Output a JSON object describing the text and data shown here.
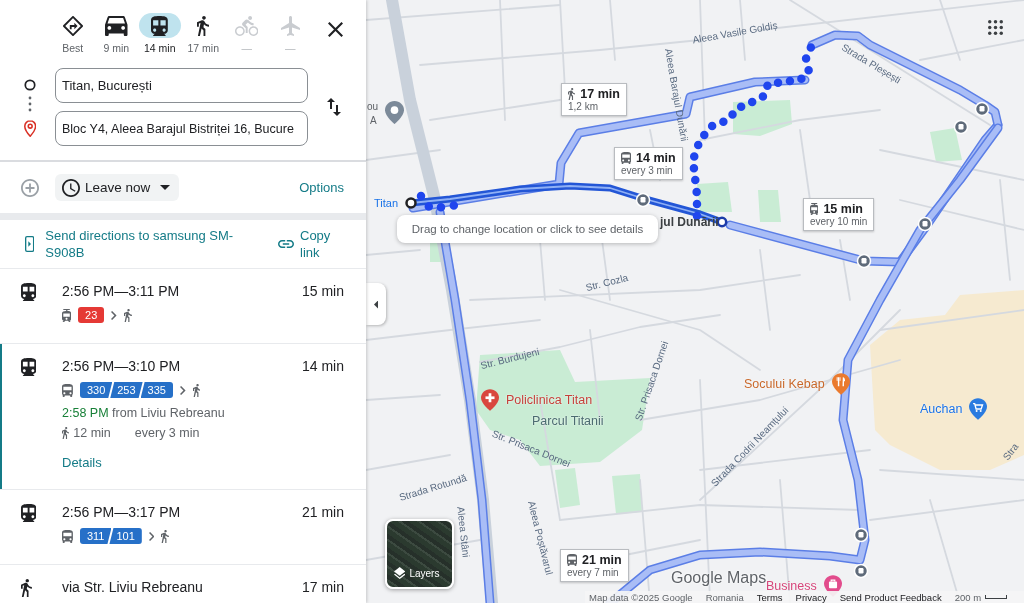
{
  "travel_modes": [
    {
      "kind": "best",
      "label": "Best",
      "selected": false,
      "disabled": false
    },
    {
      "kind": "car",
      "label": "9 min",
      "selected": false,
      "disabled": false
    },
    {
      "kind": "transit",
      "label": "14 min",
      "selected": true,
      "disabled": false
    },
    {
      "kind": "walk",
      "label": "17 min",
      "selected": false,
      "disabled": false
    },
    {
      "kind": "bike",
      "label": "—",
      "selected": false,
      "disabled": true
    },
    {
      "kind": "flight",
      "label": "—",
      "selected": false,
      "disabled": true
    }
  ],
  "origin": {
    "value": "Titan, București"
  },
  "destination": {
    "value": "Bloc Y4, Aleea Barajul Bistriței 16, Bucure"
  },
  "departure_menu": {
    "label": "Leave now"
  },
  "options_link": "Options",
  "share": {
    "send_label": "Send directions to samsung SM-S908B",
    "copy_label": "Copy link"
  },
  "routes": [
    {
      "kind": "transit",
      "selected": false,
      "times": "2:56 PM—3:11 PM",
      "duration": "15 min",
      "legs": [
        {
          "kind": "tram",
          "lines": [
            {
              "name": "23",
              "color": "#e53935"
            }
          ]
        },
        {
          "kind": "walk"
        }
      ]
    },
    {
      "kind": "transit",
      "selected": true,
      "times": "2:56 PM—3:10 PM",
      "duration": "14 min",
      "legs": [
        {
          "kind": "bus",
          "lines": [
            {
              "name": "330",
              "color": "#2670c8"
            },
            {
              "name": "253",
              "color": "#2670c8"
            },
            {
              "name": "335",
              "color": "#2670c8"
            }
          ]
        },
        {
          "kind": "walk"
        }
      ],
      "departure_time": "2:58 PM",
      "departure_place": "from Liviu Rebreanu",
      "walk_time": "12 min",
      "frequency": "every 3 min",
      "details_link": "Details"
    },
    {
      "kind": "transit",
      "selected": false,
      "times": "2:56 PM—3:17 PM",
      "duration": "21 min",
      "legs": [
        {
          "kind": "bus",
          "lines": [
            {
              "name": "311",
              "color": "#2670c8"
            },
            {
              "name": "101",
              "color": "#2670c8"
            }
          ]
        },
        {
          "kind": "walk"
        }
      ]
    },
    {
      "kind": "walk",
      "selected": false,
      "summary": "via Str. Liviu Rebreanu",
      "duration": "17 min"
    }
  ],
  "map": {
    "tooltip": "Drag to change location or click to see details",
    "place_labels": [
      {
        "kind": "origin",
        "text": "Titan"
      },
      {
        "kind": "stop",
        "text": "jul Dunării"
      },
      {
        "kind": "partial",
        "text": "ou"
      },
      {
        "kind": "partial",
        "text": "A"
      }
    ],
    "streets": [
      "Aleea Vasile Goldiș",
      "Strada Pleșești",
      "Aleea Barajul Dunării",
      "Str. Cozla",
      "Str. Burdujeni",
      "Str. Prisaca Dornei",
      "Str. Prisaca Dornei",
      "Strada Rotundă",
      "Aleea Stâni",
      "Aleea Poștăvarul",
      "Strada Codrii Neamțului",
      "Stra"
    ],
    "pois": [
      {
        "kind": "hospital",
        "name": "Policlinica Titan"
      },
      {
        "kind": "park",
        "name": "Parcul Titanii"
      },
      {
        "kind": "restaurant",
        "name": "Socului Kebap"
      },
      {
        "kind": "shop",
        "name": "Auchan"
      },
      {
        "kind": "business",
        "name": "Business"
      }
    ],
    "callouts": [
      {
        "kind": "walk",
        "time": "17 min",
        "detail": "1,2 km"
      },
      {
        "kind": "bus",
        "time": "14 min",
        "detail": "every 3 min"
      },
      {
        "kind": "tram",
        "time": "15 min",
        "detail": "every 10 min"
      },
      {
        "kind": "bus",
        "time": "21 min",
        "detail": "every 7 min"
      }
    ],
    "layers_label": "Layers",
    "logo": "Google Maps",
    "attribution": [
      {
        "kind": "text",
        "text": "Map data ©2025 Google"
      },
      {
        "kind": "text",
        "text": "Romania"
      },
      {
        "kind": "link",
        "text": "Terms"
      },
      {
        "kind": "link",
        "text": "Privacy"
      },
      {
        "kind": "link",
        "text": "Send Product Feedback"
      }
    ],
    "scale": "200 m"
  }
}
